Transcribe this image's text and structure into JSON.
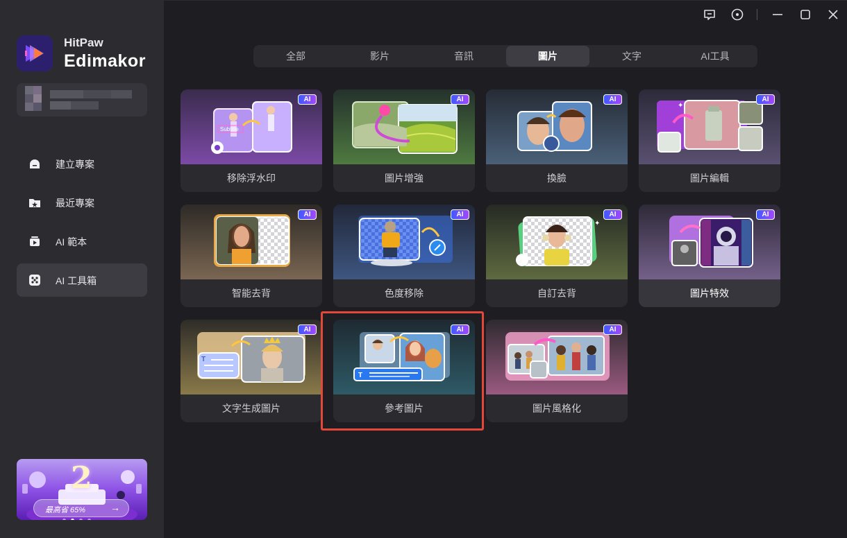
{
  "app": {
    "brand_top": "HitPaw",
    "brand_main": "Edimakor"
  },
  "sidebar": {
    "items": [
      {
        "label": "建立專案",
        "icon": "new-project-icon",
        "active": false
      },
      {
        "label": "最近專案",
        "icon": "recent-folder-icon",
        "active": false
      },
      {
        "label": "AI 範本",
        "icon": "template-icon",
        "active": false
      },
      {
        "label": "AI 工具箱",
        "icon": "toolbox-icon",
        "active": true
      }
    ],
    "promo": {
      "text": "最高省 65%",
      "number": "2"
    }
  },
  "window_controls": [
    "feedback-icon",
    "settings-icon",
    "minimize-icon",
    "maximize-icon",
    "close-icon"
  ],
  "tabs": [
    {
      "label": "全部",
      "active": false
    },
    {
      "label": "影片",
      "active": false
    },
    {
      "label": "音訊",
      "active": false
    },
    {
      "label": "圖片",
      "active": true
    },
    {
      "label": "文字",
      "active": false
    },
    {
      "label": "AI工具",
      "active": false
    }
  ],
  "badge_label": "AI",
  "cards": [
    {
      "label": "移除浮水印",
      "ai": true,
      "overlay_text": "Subtitle"
    },
    {
      "label": "圖片增強",
      "ai": true
    },
    {
      "label": "換臉",
      "ai": true
    },
    {
      "label": "圖片編輯",
      "ai": true
    },
    {
      "label": "智能去背",
      "ai": true
    },
    {
      "label": "色度移除",
      "ai": true
    },
    {
      "label": "自訂去背",
      "ai": true
    },
    {
      "label": "圖片特效",
      "ai": true,
      "hovered": true
    },
    {
      "label": "文字生成圖片",
      "ai": true
    },
    {
      "label": "參考圖片",
      "ai": true,
      "highlighted": true
    },
    {
      "label": "圖片風格化",
      "ai": true
    }
  ],
  "colors": {
    "accent": "#6a3cf0",
    "highlight_border": "#e3483a",
    "background": "#1e1e22",
    "sidebar": "#2b2b30"
  }
}
